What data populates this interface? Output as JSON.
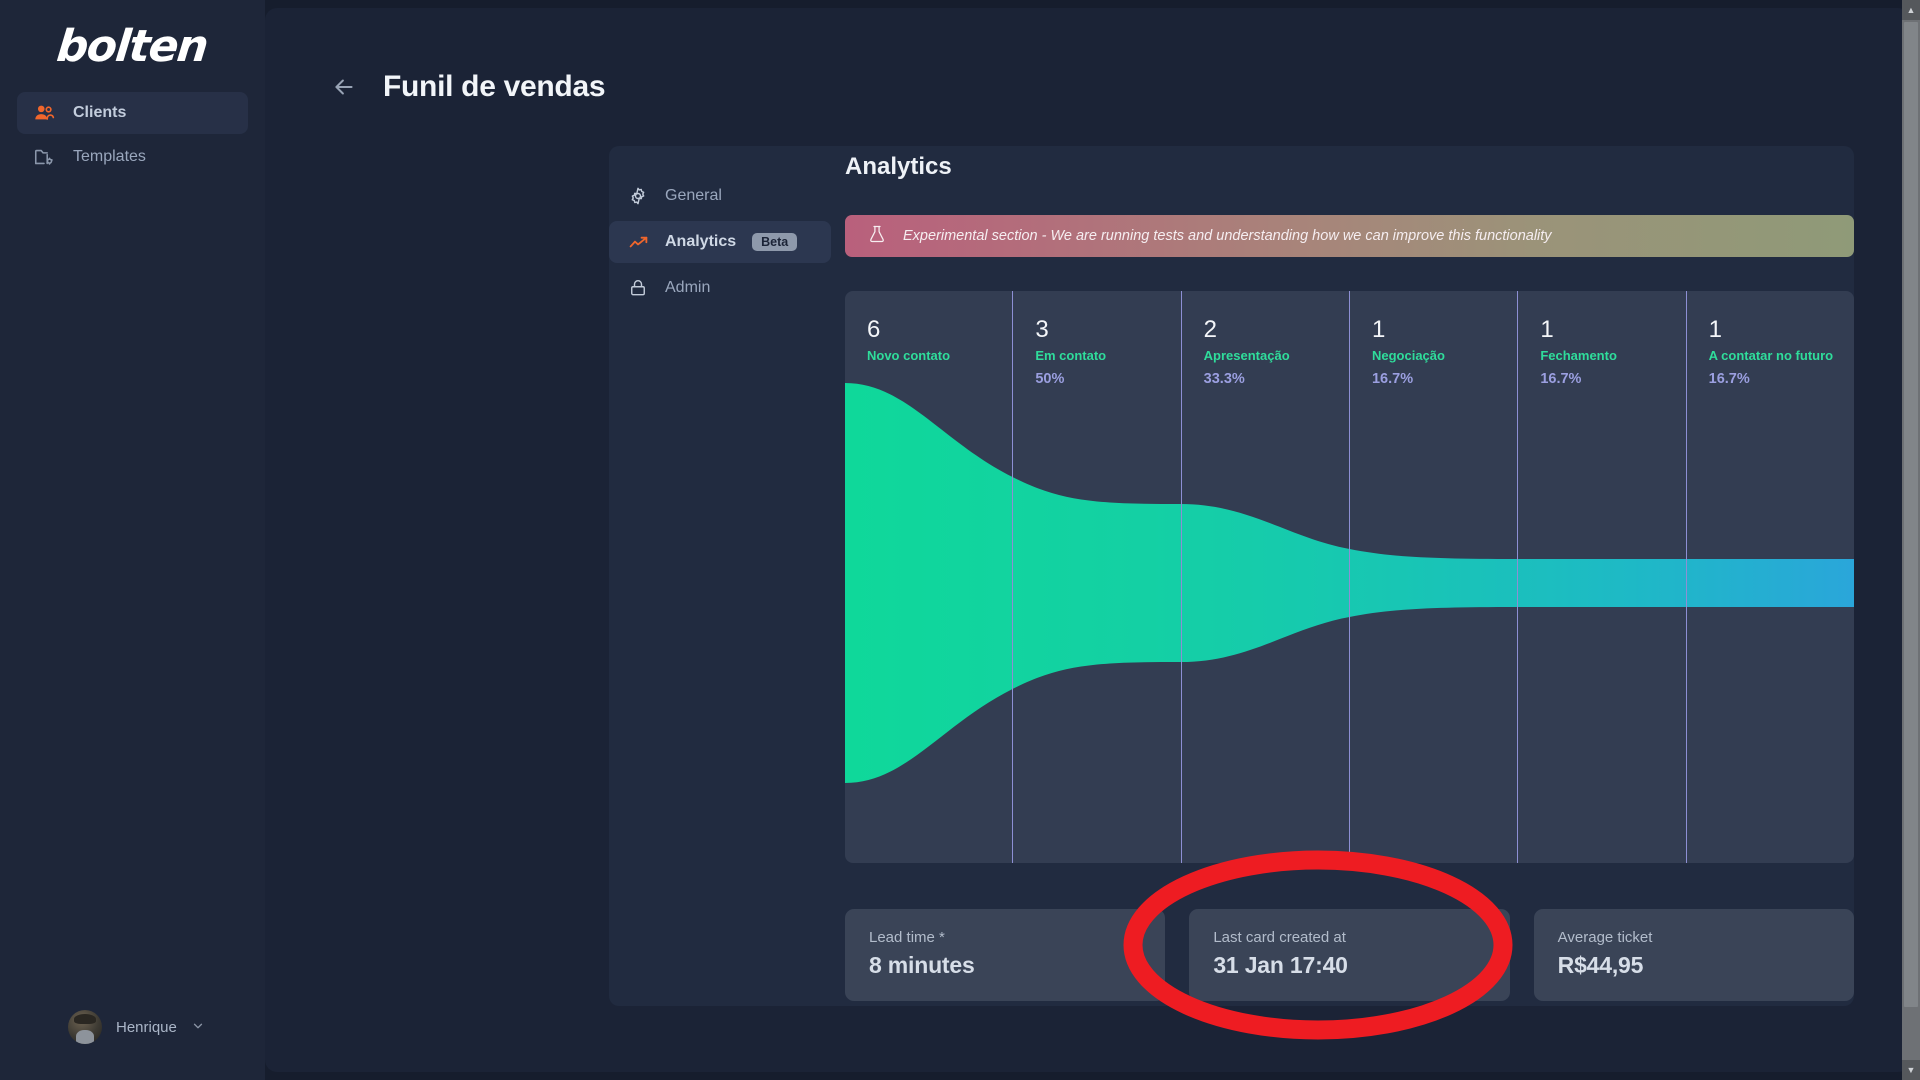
{
  "sidebar": {
    "logo": "bolten",
    "items": [
      {
        "label": "Clients",
        "icon": "users-icon",
        "active": true
      },
      {
        "label": "Templates",
        "icon": "folder-cog-icon",
        "active": false
      }
    ],
    "user": {
      "name": "Henrique",
      "chevron": "chevron-down-icon"
    }
  },
  "header": {
    "back_icon": "arrow-left-icon",
    "title": "Funil de vendas"
  },
  "subnav": {
    "items": [
      {
        "label": "General",
        "icon": "gear-icon",
        "badge": "",
        "active": false
      },
      {
        "label": "Analytics",
        "icon": "trending-up-icon",
        "badge": "Beta",
        "active": true
      },
      {
        "label": "Admin",
        "icon": "lock-icon",
        "badge": "",
        "active": false
      }
    ]
  },
  "panel": {
    "title": "Analytics",
    "banner": {
      "icon": "flask-icon",
      "text": "Experimental section - We are running tests and understanding how we can improve this functionality"
    }
  },
  "chart_data": {
    "type": "area",
    "title": "Funil de vendas",
    "categories": [
      "Novo contato",
      "Em contato",
      "Apresentação",
      "Negociação",
      "Fechamento",
      "A contatar no futuro"
    ],
    "values": [
      6,
      3,
      2,
      1,
      1,
      1
    ],
    "percents": [
      "",
      "50%",
      "33.3%",
      "16.7%",
      "16.7%",
      "16.7%"
    ],
    "xlabel": "",
    "ylabel": "",
    "ylim": [
      0,
      6
    ],
    "grid": true,
    "legend": "none",
    "colors": {
      "stage_name": "#2fdd9b",
      "percent": "#9b9fe0",
      "count": "#f4f6f9",
      "funnel_start": "#12d39a",
      "funnel_mid": "#18c6b2",
      "funnel_end": "#29a8d8",
      "plot_bg": "#333d52",
      "divider": "#8d8fd4"
    }
  },
  "metrics": [
    {
      "label": "Lead time *",
      "value": "8 minutes"
    },
    {
      "label": "Last card created at",
      "value": "31 Jan 17:40"
    },
    {
      "label": "Average ticket",
      "value": "R$44,95"
    }
  ],
  "annotation": {
    "shape": "ellipse",
    "color": "#ee1c22",
    "target": "Average ticket"
  },
  "scrollbars": {
    "vertical": {
      "up": "▲",
      "down": "▼"
    },
    "horizontal": {
      "left": "◀",
      "right": "▶"
    }
  }
}
